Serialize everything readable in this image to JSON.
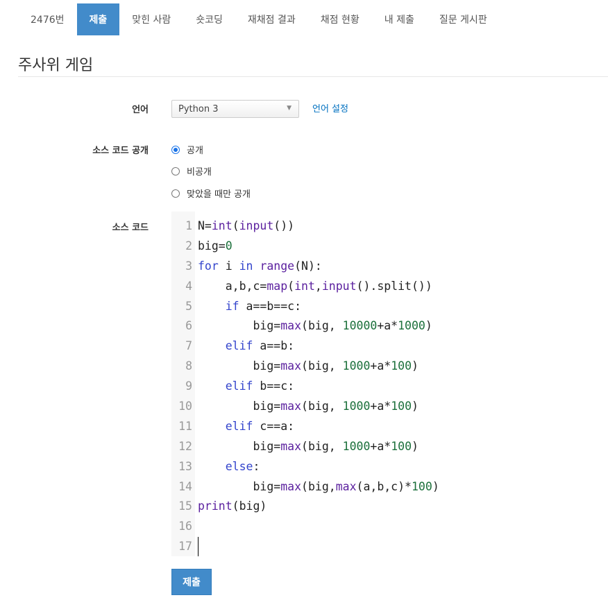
{
  "tabs": [
    {
      "label": "2476번",
      "active": false
    },
    {
      "label": "제출",
      "active": true
    },
    {
      "label": "맞힌 사람",
      "active": false
    },
    {
      "label": "숏코딩",
      "active": false
    },
    {
      "label": "재채점 결과",
      "active": false
    },
    {
      "label": "채점 현황",
      "active": false
    },
    {
      "label": "내 제출",
      "active": false
    },
    {
      "label": "질문 게시판",
      "active": false
    }
  ],
  "page": {
    "title": "주사위 게임"
  },
  "form": {
    "language_label": "언어",
    "language_value": "Python 3",
    "language_settings_link": "언어 설정",
    "visibility_label": "소스 코드 공개",
    "visibility_options": [
      {
        "label": "공개",
        "checked": true
      },
      {
        "label": "비공개",
        "checked": false
      },
      {
        "label": "맞았을 때만 공개",
        "checked": false
      }
    ],
    "source_label": "소스 코드",
    "submit_label": "제출"
  },
  "code": {
    "line_numbers": [
      "1",
      "2",
      "3",
      "4",
      "5",
      "6",
      "7",
      "8",
      "9",
      "10",
      "11",
      "12",
      "13",
      "14",
      "15",
      "16",
      "17"
    ],
    "lines": [
      [
        [
          "t",
          "N="
        ],
        [
          "b",
          "int"
        ],
        [
          "t",
          "("
        ],
        [
          "b",
          "input"
        ],
        [
          "t",
          "())"
        ]
      ],
      [
        [
          "t",
          "big="
        ],
        [
          "n",
          "0"
        ]
      ],
      [
        [
          "k",
          "for"
        ],
        [
          "t",
          " i "
        ],
        [
          "k",
          "in"
        ],
        [
          "t",
          " "
        ],
        [
          "b",
          "range"
        ],
        [
          "t",
          "(N):"
        ]
      ],
      [
        [
          "t",
          "    a,b,c="
        ],
        [
          "b",
          "map"
        ],
        [
          "t",
          "("
        ],
        [
          "b",
          "int"
        ],
        [
          "t",
          ","
        ],
        [
          "b",
          "input"
        ],
        [
          "t",
          "().split())"
        ]
      ],
      [
        [
          "t",
          "    "
        ],
        [
          "k",
          "if"
        ],
        [
          "t",
          " a==b==c:"
        ]
      ],
      [
        [
          "t",
          "        big="
        ],
        [
          "b",
          "max"
        ],
        [
          "t",
          "(big, "
        ],
        [
          "n",
          "10000"
        ],
        [
          "t",
          "+a*"
        ],
        [
          "n",
          "1000"
        ],
        [
          "t",
          ")"
        ]
      ],
      [
        [
          "t",
          "    "
        ],
        [
          "k",
          "elif"
        ],
        [
          "t",
          " a==b:"
        ]
      ],
      [
        [
          "t",
          "        big="
        ],
        [
          "b",
          "max"
        ],
        [
          "t",
          "(big, "
        ],
        [
          "n",
          "1000"
        ],
        [
          "t",
          "+a*"
        ],
        [
          "n",
          "100"
        ],
        [
          "t",
          ")"
        ]
      ],
      [
        [
          "t",
          "    "
        ],
        [
          "k",
          "elif"
        ],
        [
          "t",
          " b==c:"
        ]
      ],
      [
        [
          "t",
          "        big="
        ],
        [
          "b",
          "max"
        ],
        [
          "t",
          "(big, "
        ],
        [
          "n",
          "1000"
        ],
        [
          "t",
          "+a*"
        ],
        [
          "n",
          "100"
        ],
        [
          "t",
          ")"
        ]
      ],
      [
        [
          "t",
          "    "
        ],
        [
          "k",
          "elif"
        ],
        [
          "t",
          " c==a:"
        ]
      ],
      [
        [
          "t",
          "        big="
        ],
        [
          "b",
          "max"
        ],
        [
          "t",
          "(big, "
        ],
        [
          "n",
          "1000"
        ],
        [
          "t",
          "+a*"
        ],
        [
          "n",
          "100"
        ],
        [
          "t",
          ")"
        ]
      ],
      [
        [
          "t",
          "    "
        ],
        [
          "k",
          "else"
        ],
        [
          "t",
          ":"
        ]
      ],
      [
        [
          "t",
          "        big="
        ],
        [
          "b",
          "max"
        ],
        [
          "t",
          "(big,"
        ],
        [
          "b",
          "max"
        ],
        [
          "t",
          "(a,b,c)*"
        ],
        [
          "n",
          "100"
        ],
        [
          "t",
          ")"
        ]
      ],
      [
        [
          "b",
          "print"
        ],
        [
          "t",
          "(big)"
        ]
      ],
      [],
      []
    ]
  },
  "colors": {
    "accent": "#428bca",
    "link": "#0070c0",
    "keyword": "#3344cc",
    "builtin": "#5a1f9e",
    "number": "#1a6f3a"
  }
}
